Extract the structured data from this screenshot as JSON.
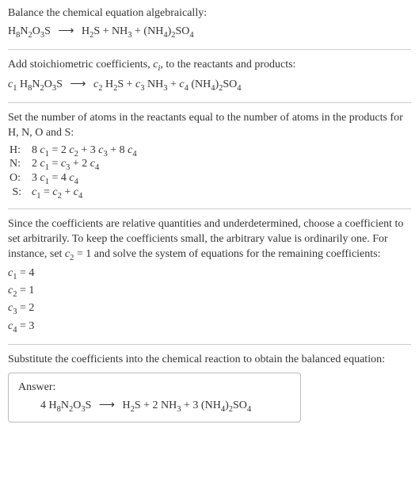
{
  "section1": {
    "title": "Balance the chemical equation algebraically:",
    "eq_left": "H",
    "eq_left_sub1": "8",
    "eq_left2": "N",
    "eq_left_sub2": "2",
    "eq_left3": "O",
    "eq_left_sub3": "3",
    "eq_left4": "S",
    "arrow": "⟶",
    "eq_r1": "H",
    "eq_r1_sub": "2",
    "eq_r1b": "S + NH",
    "eq_r2_sub": "3",
    "eq_r3": " + (NH",
    "eq_r3_sub": "4",
    "eq_r4": ")",
    "eq_r4_sub": "2",
    "eq_r5": "SO",
    "eq_r5_sub": "4"
  },
  "section2": {
    "title_a": "Add stoichiometric coefficients, ",
    "title_ci": "c",
    "title_ci_sub": "i",
    "title_b": ", to the reactants and products:",
    "c1": "c",
    "c1_sub": "1",
    "sp1": " H",
    "sp1_sub1": "8",
    "sp1b": "N",
    "sp1_sub2": "2",
    "sp1c": "O",
    "sp1_sub3": "3",
    "sp1d": "S",
    "arrow": "⟶",
    "c2": "c",
    "c2_sub": "2",
    "sp2": " H",
    "sp2_sub": "2",
    "sp2b": "S + ",
    "c3": "c",
    "c3_sub": "3",
    "sp3": " NH",
    "sp3_sub": "3",
    "sp3b": " + ",
    "c4": "c",
    "c4_sub": "4",
    "sp4": " (NH",
    "sp4_sub1": "4",
    "sp4b": ")",
    "sp4_sub2": "2",
    "sp4c": "SO",
    "sp4_sub3": "4"
  },
  "section3": {
    "intro": "Set the number of atoms in the reactants equal to the number of atoms in the products for H, N, O and S:",
    "rows": [
      {
        "label": "H:",
        "c1a": "8 ",
        "c1": "c",
        "c1_sub": "1",
        "eq": " = 2 ",
        "c2": "c",
        "c2_sub": "2",
        "mid": " + 3 ",
        "c3": "c",
        "c3_sub": "3",
        "mid2": " + 8 ",
        "c4": "c",
        "c4_sub": "4"
      },
      {
        "label": "N:",
        "c1a": "2 ",
        "c1": "c",
        "c1_sub": "1",
        "eq": " = ",
        "c2": "c",
        "c2_sub": "3",
        "mid": " + 2 ",
        "c3": "c",
        "c3_sub": "4",
        "mid2": "",
        "c4": "",
        "c4_sub": ""
      },
      {
        "label": "O:",
        "c1a": "3 ",
        "c1": "c",
        "c1_sub": "1",
        "eq": " = 4 ",
        "c2": "c",
        "c2_sub": "4",
        "mid": "",
        "c3": "",
        "c3_sub": "",
        "mid2": "",
        "c4": "",
        "c4_sub": ""
      },
      {
        "label": " S:",
        "c1a": "",
        "c1": "c",
        "c1_sub": "1",
        "eq": " = ",
        "c2": "c",
        "c2_sub": "2",
        "mid": " + ",
        "c3": "c",
        "c3_sub": "4",
        "mid2": "",
        "c4": "",
        "c4_sub": ""
      }
    ]
  },
  "section4": {
    "intro_a": "Since the coefficients are relative quantities and underdetermined, choose a coefficient to set arbitrarily. To keep the coefficients small, the arbitrary value is ordinarily one. For instance, set ",
    "cvar": "c",
    "cvar_sub": "2",
    "intro_b": " = 1 and solve the system of equations for the remaining coefficients:",
    "coeffs": [
      {
        "c": "c",
        "sub": "1",
        "val": " = 4"
      },
      {
        "c": "c",
        "sub": "2",
        "val": " = 1"
      },
      {
        "c": "c",
        "sub": "3",
        "val": " = 2"
      },
      {
        "c": "c",
        "sub": "4",
        "val": " = 3"
      }
    ]
  },
  "section5": {
    "intro": "Substitute the coefficients into the chemical reaction to obtain the balanced equation:",
    "answer_label": "Answer:",
    "eq": {
      "n1": "4 H",
      "s1": "8",
      "n2": "N",
      "s2": "2",
      "n3": "O",
      "s3": "3",
      "n4": "S",
      "arrow": "⟶",
      "n5": "H",
      "s5": "2",
      "n6": "S + 2 NH",
      "s6": "3",
      "n7": " + 3 (NH",
      "s7": "4",
      "n8": ")",
      "s8": "2",
      "n9": "SO",
      "s9": "4"
    }
  }
}
